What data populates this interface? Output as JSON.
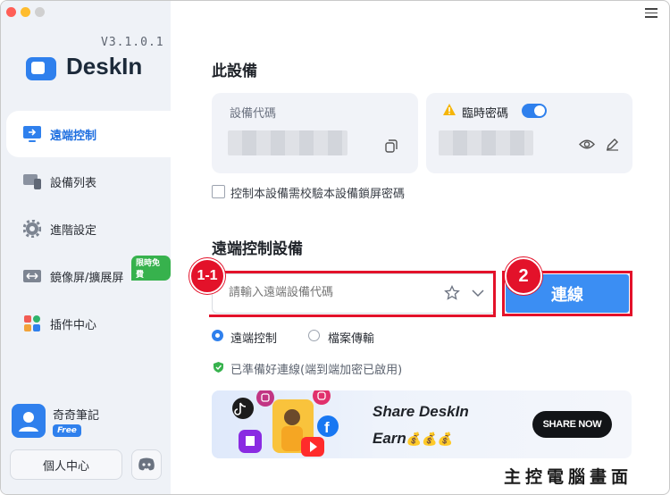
{
  "app": {
    "version": "V3.1.0.1",
    "brand": "DeskIn",
    "colors": {
      "accent": "#2f80ed",
      "highlight": "#e3122a",
      "sidebar_bg": "#eff2f7"
    }
  },
  "sidebar": {
    "items": [
      {
        "label": "遠端控制",
        "icon": "monitor-remote-icon",
        "active": true
      },
      {
        "label": "設備列表",
        "icon": "devices-icon",
        "active": false
      },
      {
        "label": "進階設定",
        "icon": "gear-icon",
        "active": false
      },
      {
        "label": "鏡像屏/擴展屏",
        "icon": "mirror-screen-icon",
        "active": false,
        "badge": "限時免費"
      },
      {
        "label": "插件中心",
        "icon": "plugin-grid-icon",
        "active": false
      }
    ],
    "user": {
      "name": "奇奇筆記",
      "plan": "Free"
    },
    "personal_center": "個人中心",
    "discord_icon": "discord-icon"
  },
  "this_device": {
    "title": "此設備",
    "device_code_label": "設備代碼",
    "temp_password_label": "臨時密碼",
    "temp_password_enabled": true,
    "verify_lock_label": "控制本設備需校驗本設備鎖屏密碼",
    "verify_lock_checked": false
  },
  "remote": {
    "title": "遠端控制設備",
    "input_placeholder": "請輸入遠端設備代碼",
    "connect_label": "連線",
    "mode_remote": "遠端控制",
    "mode_file": "檔案傳輸",
    "selected_mode": "遠端控制",
    "status": "已準備好連線(端到端加密已啟用)"
  },
  "annotations": {
    "step_1": "1-1",
    "step_2": "2"
  },
  "banner": {
    "title": "Share DeskIn",
    "earn": "Earn",
    "money_icons": "💰💰💰",
    "button": "SHARE NOW"
  },
  "caption": "主控電腦畫面"
}
